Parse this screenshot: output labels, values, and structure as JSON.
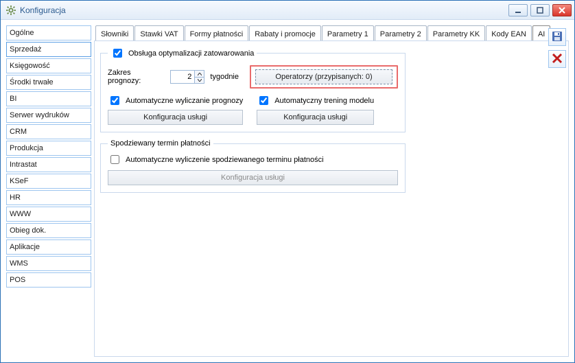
{
  "window": {
    "title": "Konfiguracja"
  },
  "sidebar": {
    "items": [
      {
        "label": "Ogólne"
      },
      {
        "label": "Sprzedaż",
        "selected": true
      },
      {
        "label": "Księgowość"
      },
      {
        "label": "Środki trwałe"
      },
      {
        "label": "BI"
      },
      {
        "label": "Serwer wydruków"
      },
      {
        "label": "CRM"
      },
      {
        "label": "Produkcja"
      },
      {
        "label": "Intrastat"
      },
      {
        "label": "KSeF"
      },
      {
        "label": "HR"
      },
      {
        "label": "WWW"
      },
      {
        "label": "Obieg dok."
      },
      {
        "label": "Aplikacje"
      },
      {
        "label": "WMS"
      },
      {
        "label": "POS"
      }
    ]
  },
  "tabs": {
    "items": [
      {
        "label": "Słowniki"
      },
      {
        "label": "Stawki VAT"
      },
      {
        "label": "Formy płatności"
      },
      {
        "label": "Rabaty i promocje"
      },
      {
        "label": "Parametry 1"
      },
      {
        "label": "Parametry 2"
      },
      {
        "label": "Parametry KK"
      },
      {
        "label": "Kody EAN"
      },
      {
        "label": "AI",
        "selected": true
      }
    ]
  },
  "group1": {
    "legend": "Obsługa optymalizacji zatowarowania",
    "checked": true,
    "range_label": "Zakres prognozy:",
    "range_value": "2",
    "range_unit": "tygodnie",
    "operators_btn": "Operatorzy (przypisanych: 0)",
    "auto_calc_label": "Automatyczne wyliczanie prognozy",
    "auto_calc_checked": true,
    "config_btn": "Konfiguracja usługi",
    "auto_train_label": "Automatyczny trening modelu",
    "auto_train_checked": true,
    "config_btn2": "Konfiguracja usługi"
  },
  "group2": {
    "legend": "Spodziewany termin płatności",
    "auto_label": "Automatyczne wyliczenie spodziewanego terminu płatności",
    "auto_checked": false,
    "config_btn": "Konfiguracja usługi"
  },
  "tools": {
    "save": "save-icon",
    "close": "close-icon"
  }
}
